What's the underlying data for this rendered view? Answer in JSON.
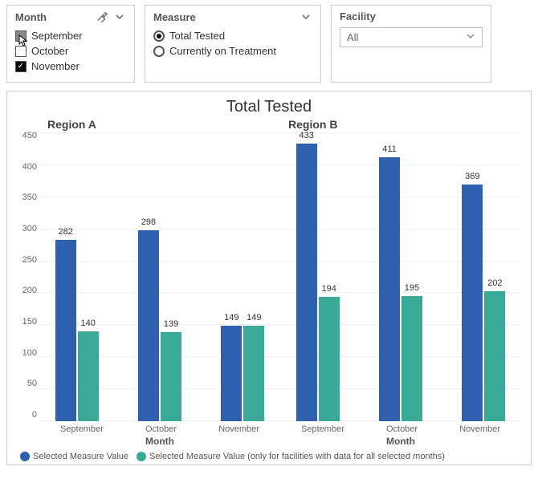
{
  "filters": {
    "month": {
      "title": "Month",
      "items": [
        {
          "label": "September",
          "checked": false,
          "hovered": true
        },
        {
          "label": "October",
          "checked": false,
          "hovered": false
        },
        {
          "label": "November",
          "checked": true,
          "hovered": false
        }
      ]
    },
    "measure": {
      "title": "Measure",
      "options": [
        {
          "label": "Total Tested",
          "selected": true
        },
        {
          "label": "Currently on Treatment",
          "selected": false
        }
      ]
    },
    "facility": {
      "title": "Facility",
      "selected": "All"
    }
  },
  "chart_data": {
    "type": "bar",
    "title": "Total Tested",
    "ylabel": "",
    "xlabel": "Month",
    "ylim": [
      0,
      450
    ],
    "yticks": [
      0,
      50,
      100,
      150,
      200,
      250,
      300,
      350,
      400,
      450
    ],
    "facets": [
      {
        "name": "Region A",
        "categories": [
          "September",
          "October",
          "November"
        ],
        "series": [
          {
            "name": "Selected Measure Value",
            "values": [
              282,
              298,
              149
            ],
            "color": "#2f5faf"
          },
          {
            "name": "Selected Measure Value (only for facilities with data for all selected months)",
            "values": [
              140,
              139,
              149
            ],
            "color": "#3aa998"
          }
        ]
      },
      {
        "name": "Region B",
        "categories": [
          "September",
          "October",
          "November"
        ],
        "series": [
          {
            "name": "Selected Measure Value",
            "values": [
              433,
              411,
              369
            ],
            "color": "#2f5faf"
          },
          {
            "name": "Selected Measure Value (only for facilities with data for all selected months)",
            "values": [
              194,
              195,
              202
            ],
            "color": "#3aa998"
          }
        ]
      }
    ],
    "legend": [
      {
        "label": "Selected Measure Value",
        "color": "#2f5faf"
      },
      {
        "label": "Selected Measure Value (only for facilities with data for all selected months)",
        "color": "#3aa998"
      }
    ]
  }
}
